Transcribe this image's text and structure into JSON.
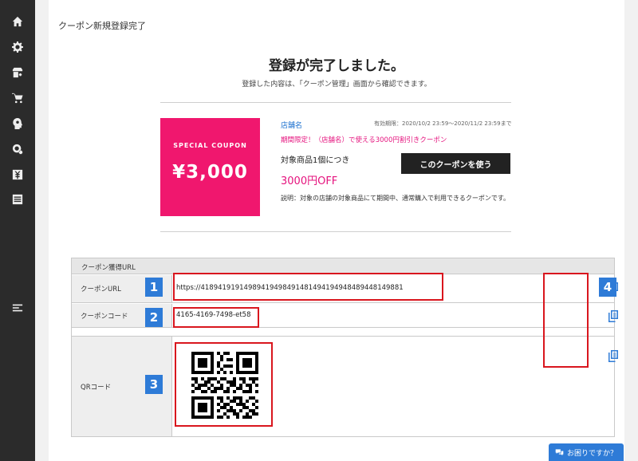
{
  "sidebar": {
    "icons": [
      "home-icon",
      "gear-icon",
      "store-gear-icon",
      "cart-icon",
      "head-gear-icon",
      "location-gear-icon",
      "yen-icon",
      "list-icon",
      "menu-icon"
    ]
  },
  "page": {
    "title": "クーポン新規登録完了",
    "heading": "登録が完了しました。",
    "subheading": "登録した内容は、「クーポン管理」画面から確認できます。"
  },
  "coupon": {
    "label": "SPECIAL COUPON",
    "amount": "¥3,000",
    "store": "店舗名",
    "expiry": "有効期限：2020/10/2 23:59～2020/11/2 23:59まで",
    "promo": "期間限定！（店舗名）で使える3000円割引きクーポン",
    "target": "対象商品1個につき",
    "discount": "3000円OFF",
    "use_button": "このクーポンを使う",
    "description": "説明：対象の店舗の対象商品にて期間中、通常購入で利用できるクーポンです。",
    "color": "#f0176e"
  },
  "table": {
    "header": "クーポン獲得URL",
    "rows": [
      {
        "label": "クーポンURL",
        "value": "https://41894191914989419498491481494194948489448149881",
        "badge": "1"
      },
      {
        "label": "クーポンコード",
        "value": "4165-4169-7498-et58",
        "badge": "2"
      },
      {
        "label": "QRコード",
        "badge": "3"
      }
    ],
    "copy_badge": "4"
  },
  "help": {
    "label": "お困りですか？"
  },
  "colors": {
    "sidebar": "#2b2b2b",
    "accent": "#2e7bd7",
    "highlight": "#d9161e",
    "pink": "#e5127d"
  }
}
